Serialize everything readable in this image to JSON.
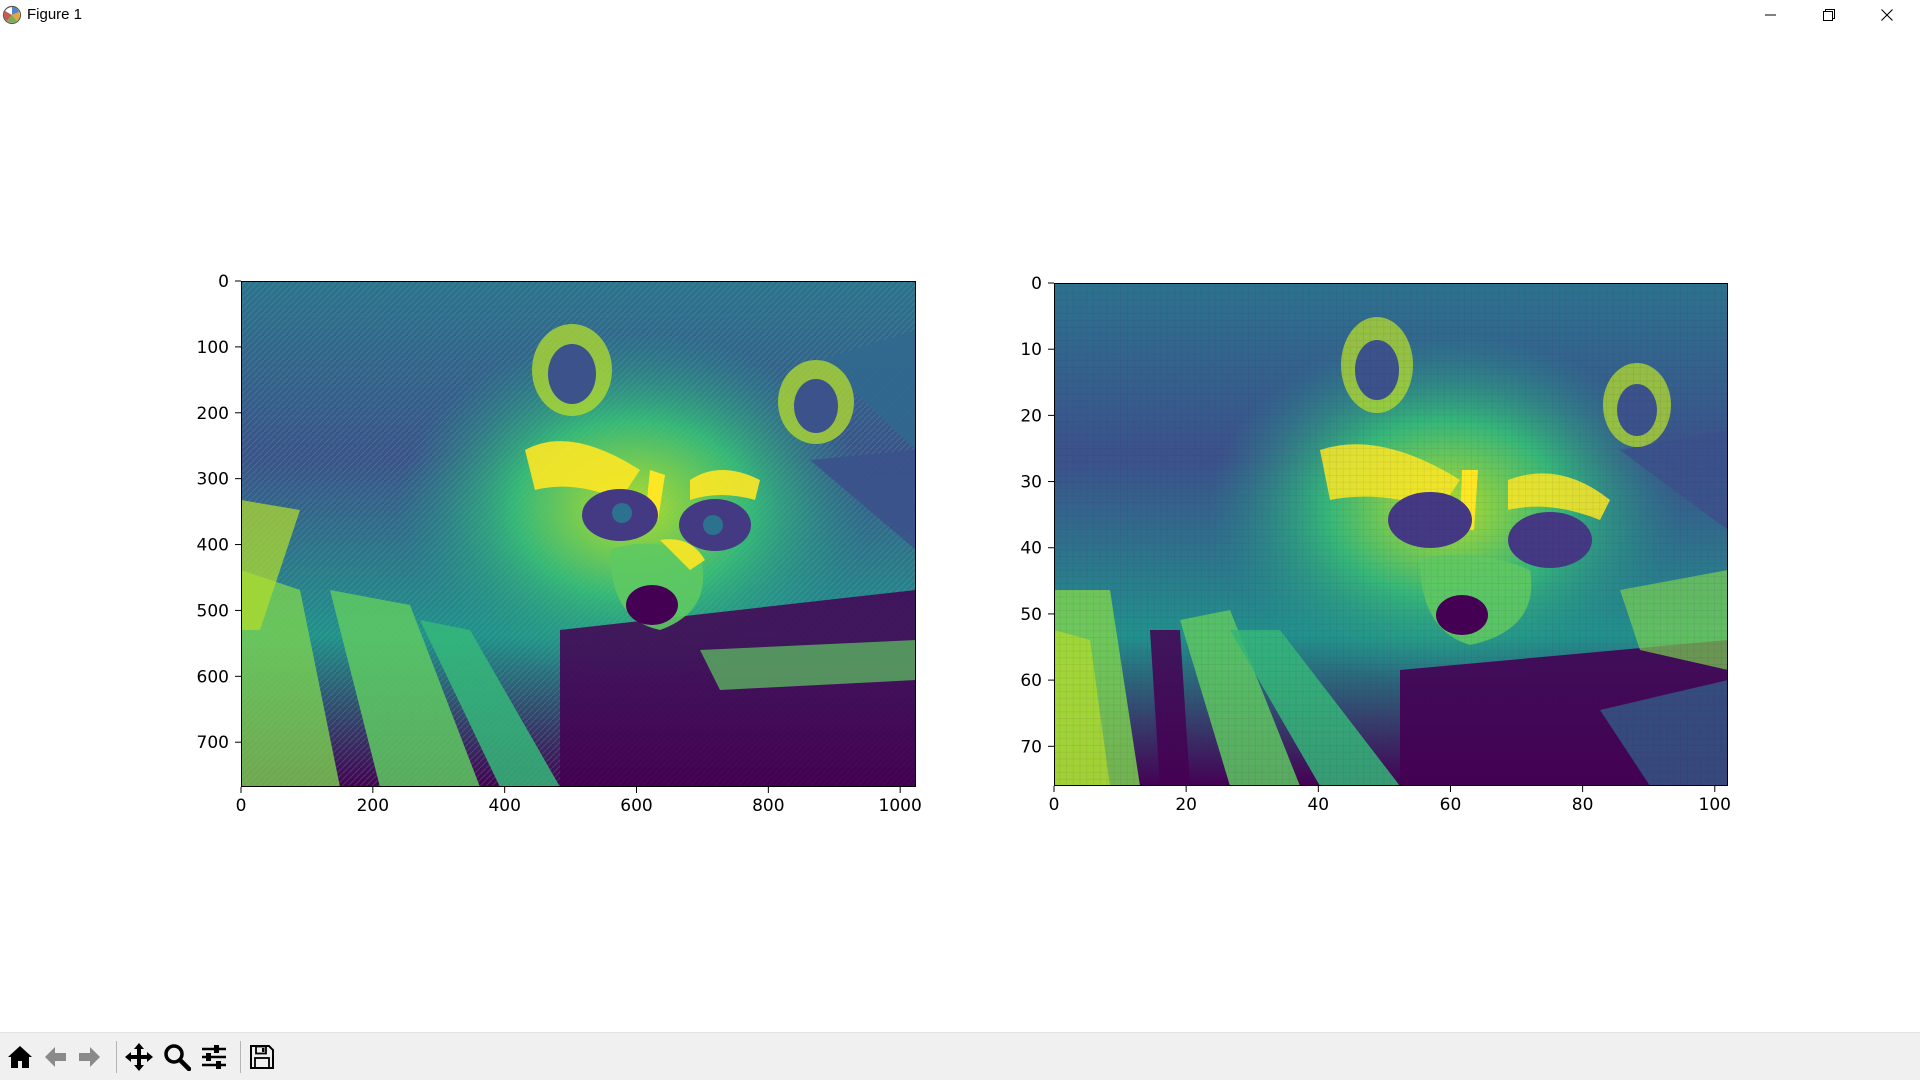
{
  "window": {
    "title": "Figure 1",
    "icons": {
      "app": "matplotlib-icon",
      "minimize": "minimize-icon",
      "restore": "restore-icon",
      "close": "close-icon"
    }
  },
  "chart_data": [
    {
      "type": "heatmap",
      "image": "raccoon-face-grayscale-viridis",
      "colormap": "viridis",
      "xlim": [
        0,
        1024
      ],
      "ylim": [
        768,
        0
      ],
      "xticks": [
        "0",
        "200",
        "400",
        "600",
        "800",
        "1000"
      ],
      "yticks": [
        "0",
        "100",
        "200",
        "300",
        "400",
        "500",
        "600",
        "700"
      ],
      "grid": false
    },
    {
      "type": "heatmap",
      "image": "raccoon-face-downsampled-viridis",
      "colormap": "viridis",
      "xlim": [
        0,
        102
      ],
      "ylim": [
        76,
        0
      ],
      "xticks": [
        "0",
        "20",
        "40",
        "60",
        "80",
        "100"
      ],
      "yticks": [
        "0",
        "10",
        "20",
        "30",
        "40",
        "50",
        "60",
        "70"
      ],
      "grid": false
    }
  ],
  "toolbar": {
    "items": [
      {
        "name": "home-icon",
        "label": "Home"
      },
      {
        "name": "back-icon",
        "label": "Back"
      },
      {
        "name": "forward-icon",
        "label": "Forward"
      },
      {
        "name": "pan-icon",
        "label": "Pan"
      },
      {
        "name": "zoom-icon",
        "label": "Zoom"
      },
      {
        "name": "subplots-icon",
        "label": "Subplots"
      },
      {
        "name": "save-icon",
        "label": "Save"
      }
    ]
  },
  "colors": {
    "viridis_dark": "#440154",
    "viridis_mid": "#21918c",
    "viridis_bright": "#fde725"
  }
}
